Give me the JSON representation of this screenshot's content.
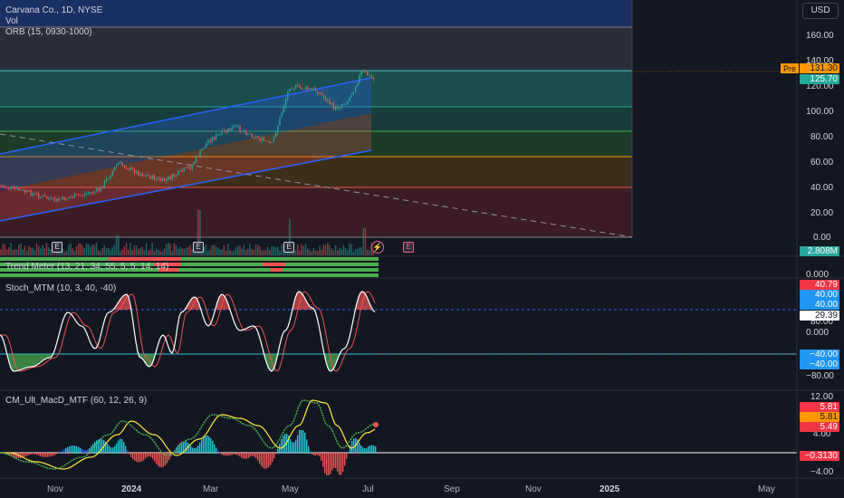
{
  "symbol": {
    "title": "Carvana Co., 1D, NYSE",
    "vol_label": "Vol",
    "orb_label": "ORB (15, 0930-1000)"
  },
  "currency_button": "USD",
  "price_axis": {
    "ticks": [
      "160.00",
      "140.00",
      "120.00",
      "100.00",
      "80.00",
      "60.00",
      "40.00",
      "20.00",
      "0.00"
    ],
    "pre_tag": "Pre",
    "pre_value": "131.30",
    "last_value": "125.70",
    "volume_value": "2.808M"
  },
  "time_axis": {
    "ticks": [
      "Nov",
      "2024",
      "Mar",
      "May",
      "Jul",
      "Sep",
      "Nov",
      "2025",
      "May"
    ]
  },
  "trend_meter": {
    "label": "Trend Meter (13, 21, 34, 55, 5, 5, 14, 14)"
  },
  "stoch": {
    "label": "Stoch_MTM (10, 3, 40, -40)",
    "axis_ticks": [
      "0.000",
      "80.00",
      "0.000",
      "−80.00"
    ],
    "badges": [
      "40.79",
      "40.00",
      "40.00",
      "29.39",
      "−40.00",
      "−40.00"
    ]
  },
  "macd": {
    "label": "CM_Ult_MacD_MTF (60, 12, 26, 9)",
    "axis_ticks": [
      "12.00",
      "4.00",
      "−4.00"
    ],
    "badges": [
      "5.81",
      "5.81",
      "5.49",
      "−0.3130"
    ]
  },
  "colors": {
    "background": "#131722",
    "up": "#26a69a",
    "down": "#ef5350",
    "channel": "#2962ff",
    "green_line": "#4caf50",
    "orange_line": "#ff9800",
    "cyan_line": "#26c6da"
  },
  "icons": [
    "earnings-e-icon",
    "dividend-flash-icon"
  ]
}
